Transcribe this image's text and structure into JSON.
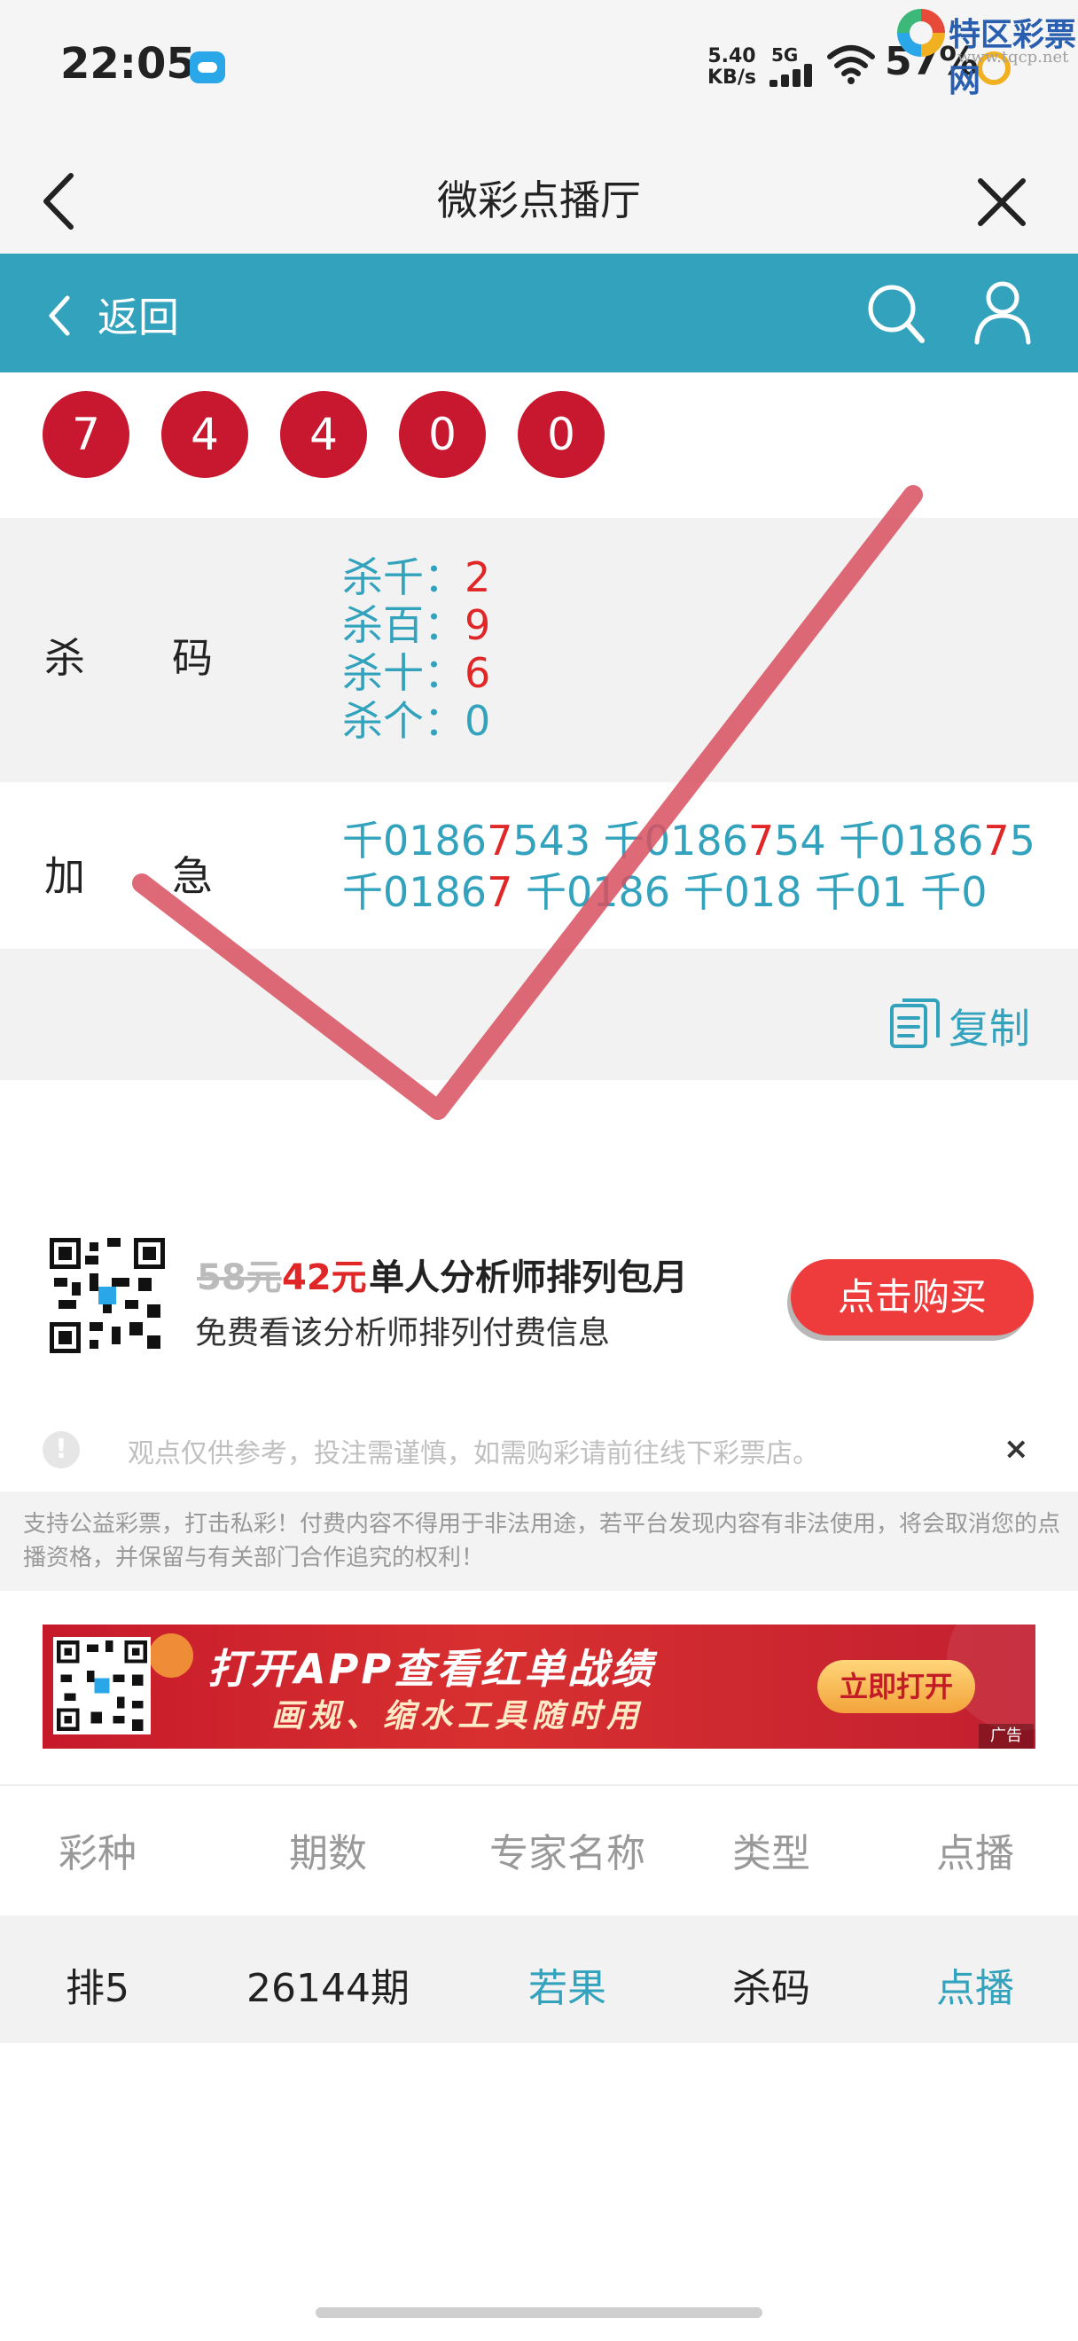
{
  "status_bar": {
    "time": "22:05",
    "net_speed_value": "5.40",
    "net_speed_unit": "KB/s",
    "network": "5G",
    "battery": "57%"
  },
  "watermark": {
    "title": "特区彩票网",
    "url": "www.tqcp.net"
  },
  "title_bar": {
    "title": "微彩点播厅"
  },
  "nav": {
    "back_label": "返回"
  },
  "balls": [
    "7",
    "4",
    "4",
    "0",
    "0"
  ],
  "kill_codes": {
    "label_1": "杀",
    "label_2": "码",
    "items": [
      {
        "name": "杀千：",
        "value": "2"
      },
      {
        "name": "杀百：",
        "value": "9"
      },
      {
        "name": "杀十：",
        "value": "6"
      },
      {
        "name": "杀个：",
        "value": "0"
      }
    ]
  },
  "jiaji": {
    "label_1": "加",
    "label_2": "急",
    "line1": [
      {
        "text": "千0186",
        "red": false
      },
      {
        "text": "7",
        "red": true
      },
      {
        "text": "543 千0186",
        "red": false
      },
      {
        "text": "7",
        "red": true
      },
      {
        "text": "54 千0186",
        "red": false
      },
      {
        "text": "7",
        "red": true
      },
      {
        "text": "5",
        "red": false
      }
    ],
    "line2": [
      {
        "text": "千0186",
        "red": false
      },
      {
        "text": "7",
        "red": true
      },
      {
        "text": " 千0186 千018 千01 千0",
        "red": false
      }
    ]
  },
  "copy": {
    "label": "复制"
  },
  "promo": {
    "old_price": "58元",
    "new_price": "42元",
    "title": "单人分析师排列包月",
    "subtitle": "免费看该分析师排列付费信息",
    "buy_label": "点击购买"
  },
  "notice": {
    "text": "观点仅供参考，投注需谨慎，如需购彩请前往线下彩票店。",
    "close": "×"
  },
  "disclaimer": {
    "text": "支持公益彩票，打击私彩！付费内容不得用于非法用途，若平台发现内容有非法使用，将会取消您的点播资格，并保留与有关部门合作追究的权利！"
  },
  "banner": {
    "title": "打开APP查看红单战绩",
    "subtitle": "画规、缩水工具随时用",
    "open_label": "立即打开",
    "ad_label": "广告"
  },
  "table": {
    "headers": [
      "彩种",
      "期数",
      "专家名称",
      "类型",
      "点播"
    ],
    "rows": [
      [
        "排5",
        "26144期",
        "若果",
        "杀码",
        "点播"
      ]
    ]
  },
  "colors": {
    "accent": "#33a3bd",
    "ball_red": "#c8182f",
    "highlight_red": "#e02626",
    "check_mark": "#d9505f"
  }
}
